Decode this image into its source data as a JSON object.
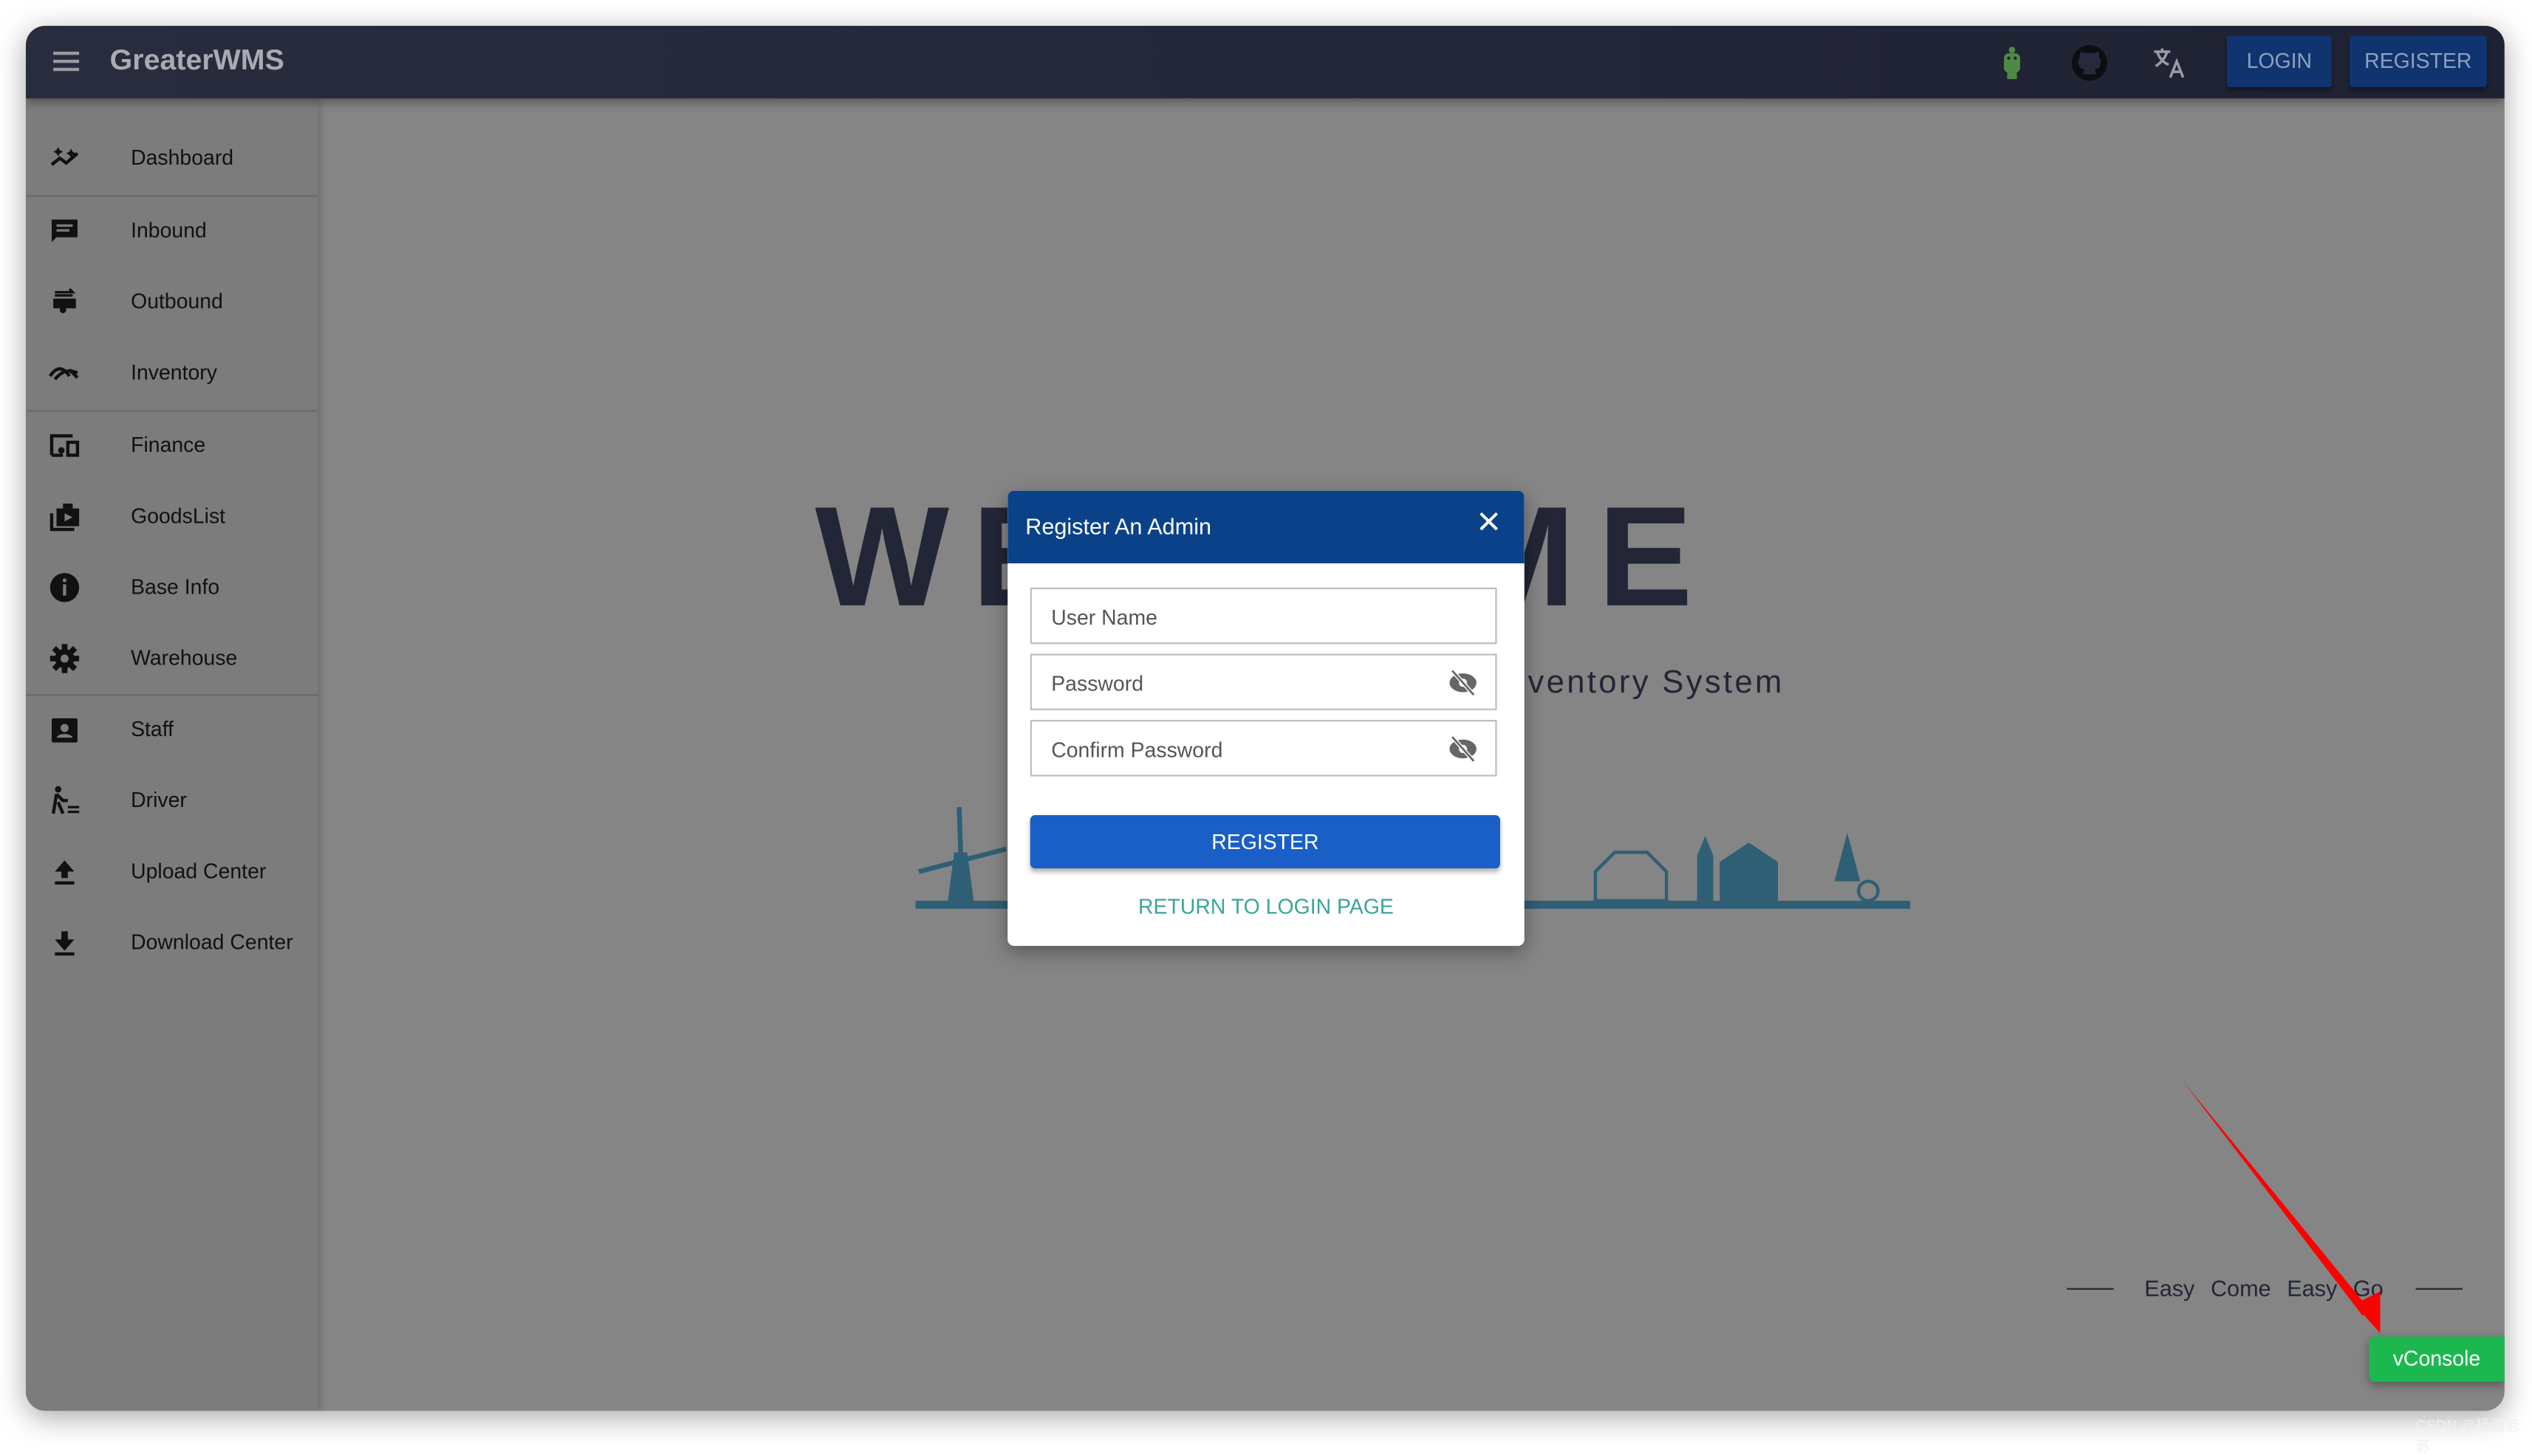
{
  "header": {
    "title": "GreaterWMS",
    "login_label": "LOGIN",
    "register_label": "REGISTER",
    "icons": [
      "menu-icon",
      "android-icon",
      "github-icon",
      "translate-icon"
    ]
  },
  "sidebar": {
    "items": [
      {
        "label": "Dashboard",
        "icon": "dashboard-icon"
      },
      {
        "label": "Inbound",
        "icon": "inbound-icon"
      },
      {
        "label": "Outbound",
        "icon": "outbound-icon"
      },
      {
        "label": "Inventory",
        "icon": "inventory-icon"
      },
      {
        "label": "Finance",
        "icon": "finance-icon"
      },
      {
        "label": "GoodsList",
        "icon": "goods-icon"
      },
      {
        "label": "Base Info",
        "icon": "info-icon"
      },
      {
        "label": "Warehouse",
        "icon": "gear-icon"
      },
      {
        "label": "Staff",
        "icon": "badge-icon"
      },
      {
        "label": "Driver",
        "icon": "driver-icon"
      },
      {
        "label": "Upload Center",
        "icon": "upload-icon"
      },
      {
        "label": "Download Center",
        "icon": "download-icon"
      }
    ]
  },
  "main": {
    "welcome": "WELCOME",
    "subtitle": "ventory System",
    "footer": "Easy Come Easy Go"
  },
  "dialog": {
    "title": "Register An Admin",
    "username_placeholder": "User Name",
    "password_placeholder": "Password",
    "confirm_placeholder": "Confirm Password",
    "register_label": "REGISTER",
    "return_label": "RETURN TO LOGIN PAGE"
  },
  "vconsole": {
    "label": "vConsole"
  },
  "watermark": "CSDN @杨浦老苏",
  "colors": {
    "header": "#262a3c",
    "dialog_header": "#0a4289",
    "primary": "#1a5fc8",
    "link": "#3aa59a",
    "vconsole": "#1cb84f",
    "annotation_arrow": "#ff0000"
  }
}
